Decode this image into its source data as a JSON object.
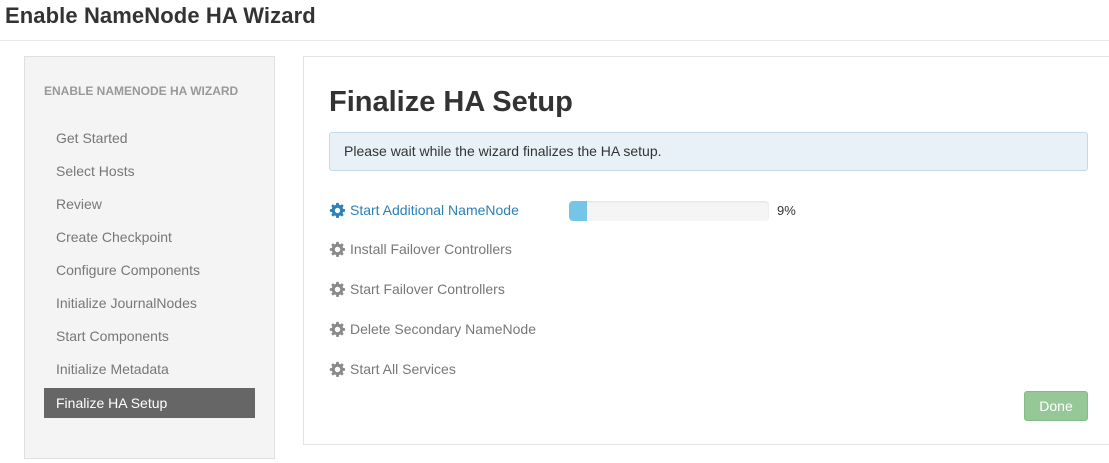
{
  "wizard": {
    "title": "Enable NameNode HA Wizard"
  },
  "sidebar": {
    "header": "ENABLE NAMENODE HA WIZARD",
    "items": [
      {
        "label": "Get Started"
      },
      {
        "label": "Select Hosts"
      },
      {
        "label": "Review"
      },
      {
        "label": "Create Checkpoint"
      },
      {
        "label": "Configure Components"
      },
      {
        "label": "Initialize JournalNodes"
      },
      {
        "label": "Start Components"
      },
      {
        "label": "Initialize Metadata"
      },
      {
        "label": "Finalize HA Setup",
        "active": true
      }
    ]
  },
  "main": {
    "title": "Finalize HA Setup",
    "alert": "Please wait while the wizard finalizes the HA setup.",
    "tasks": [
      {
        "label": "Start Additional NameNode",
        "icon": "gear-icon",
        "status": "in-progress",
        "progress": 9,
        "progress_text": "9%"
      },
      {
        "label": "Install Failover Controllers",
        "icon": "gear-icon",
        "status": "pending"
      },
      {
        "label": "Start Failover Controllers",
        "icon": "gear-icon",
        "status": "pending"
      },
      {
        "label": "Delete Secondary NameNode",
        "icon": "gear-icon",
        "status": "pending"
      },
      {
        "label": "Start All Services",
        "icon": "gear-icon",
        "status": "pending"
      }
    ],
    "done_label": "Done"
  },
  "colors": {
    "active_task": "#2a80b9",
    "pending_task": "#777777",
    "progress_fill": "#74c5e6",
    "done_button": "#96c897",
    "sidebar_active": "#666666"
  }
}
